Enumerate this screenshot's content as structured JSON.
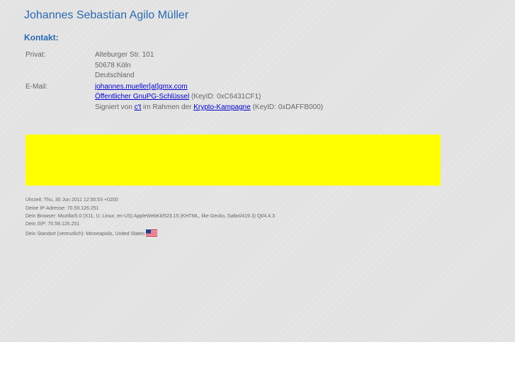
{
  "header": {
    "name": "Johannes Sebastian Agilo Müller"
  },
  "contact": {
    "heading": "Kontakt:",
    "private_label": "Privat:",
    "address_lines": [
      "Alteburger Str. 101",
      "50678 Köln",
      "Deutschland"
    ],
    "email_label": "E-Mail:",
    "email": "johannes.mueller[at]gmx.com",
    "key_link": "Öffentlicher GnuPG-Schlüssel",
    "key_id": " (KeyID: 0xC6431CF1)",
    "signed_prefix": "Signiert von ",
    "signed_by": "c't",
    "signed_middle": " im Rahmen der ",
    "campaign": "Krypto-Kampagne",
    "campaign_key": " (KeyID: 0xDAFFB000)"
  },
  "footer": {
    "time": "Uhrzeit: Thu, 30 Jun 2011 12:50:53 +0200",
    "ip": "Deine IP-Adresse: 70.59.126.251",
    "browser": "Dein Browser: Mozilla/5.0 (X11; U; Linux; en-US) AppleWebKit/523.15 (KHTML, like Gecko, Safari/419.3) Qt/4.4.3",
    "isp": "Dein ISP: 70.59.126.251",
    "location": "Dein Standort (vermutlich): Minneapolis, United States",
    "flag_icon": "us-flag-icon"
  },
  "colors": {
    "accent": "#2a6ab0",
    "banner": "#ffff00",
    "link": "#0000cc"
  }
}
